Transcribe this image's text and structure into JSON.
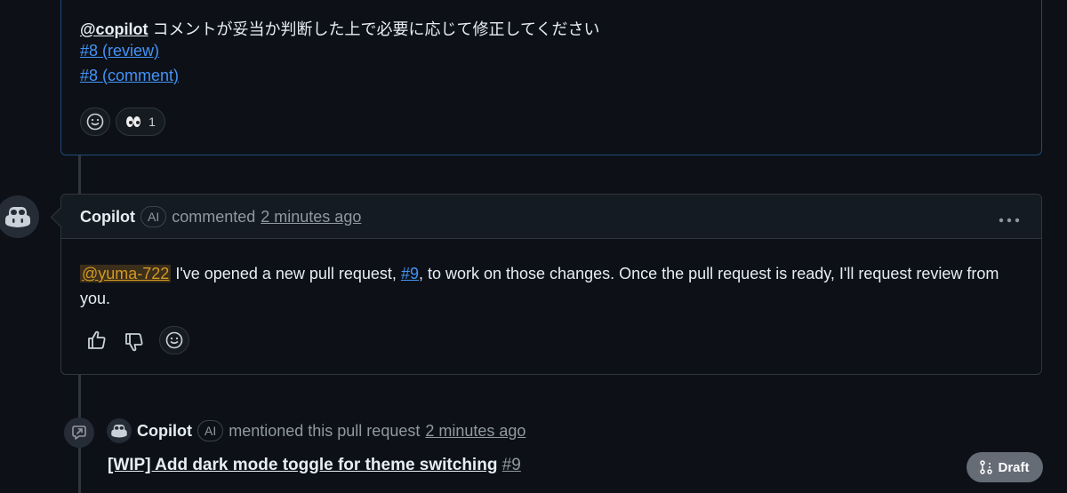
{
  "first_comment": {
    "mention": "@copilot",
    "text": " コメントが妥当か判断した上で必要に応じて修正してください",
    "links": [
      "#8 (review)",
      "#8 (comment)"
    ],
    "reaction_count": "1"
  },
  "copilot_comment": {
    "author": "Copilot",
    "badge": "AI",
    "action": "commented",
    "time": "2 minutes ago",
    "mention": "@yuma-722",
    "body_part1": " I've opened a new pull request, ",
    "pr_link": "#9",
    "body_part2": ", to work on those changes. Once the pull request is ready, I'll request review from",
    "body_part3": "you."
  },
  "mention_event": {
    "author": "Copilot",
    "badge": "AI",
    "action": "mentioned this pull request",
    "time": "2 minutes ago",
    "pr_title": "[WIP] Add dark mode toggle for theme switching",
    "pr_number": "#9",
    "status": "Draft"
  },
  "colors": {
    "background": "#0d1117",
    "link": "#4493f8",
    "mention_highlight": "#d29922",
    "border": "#30363d",
    "draft_badge": "#656c76"
  }
}
